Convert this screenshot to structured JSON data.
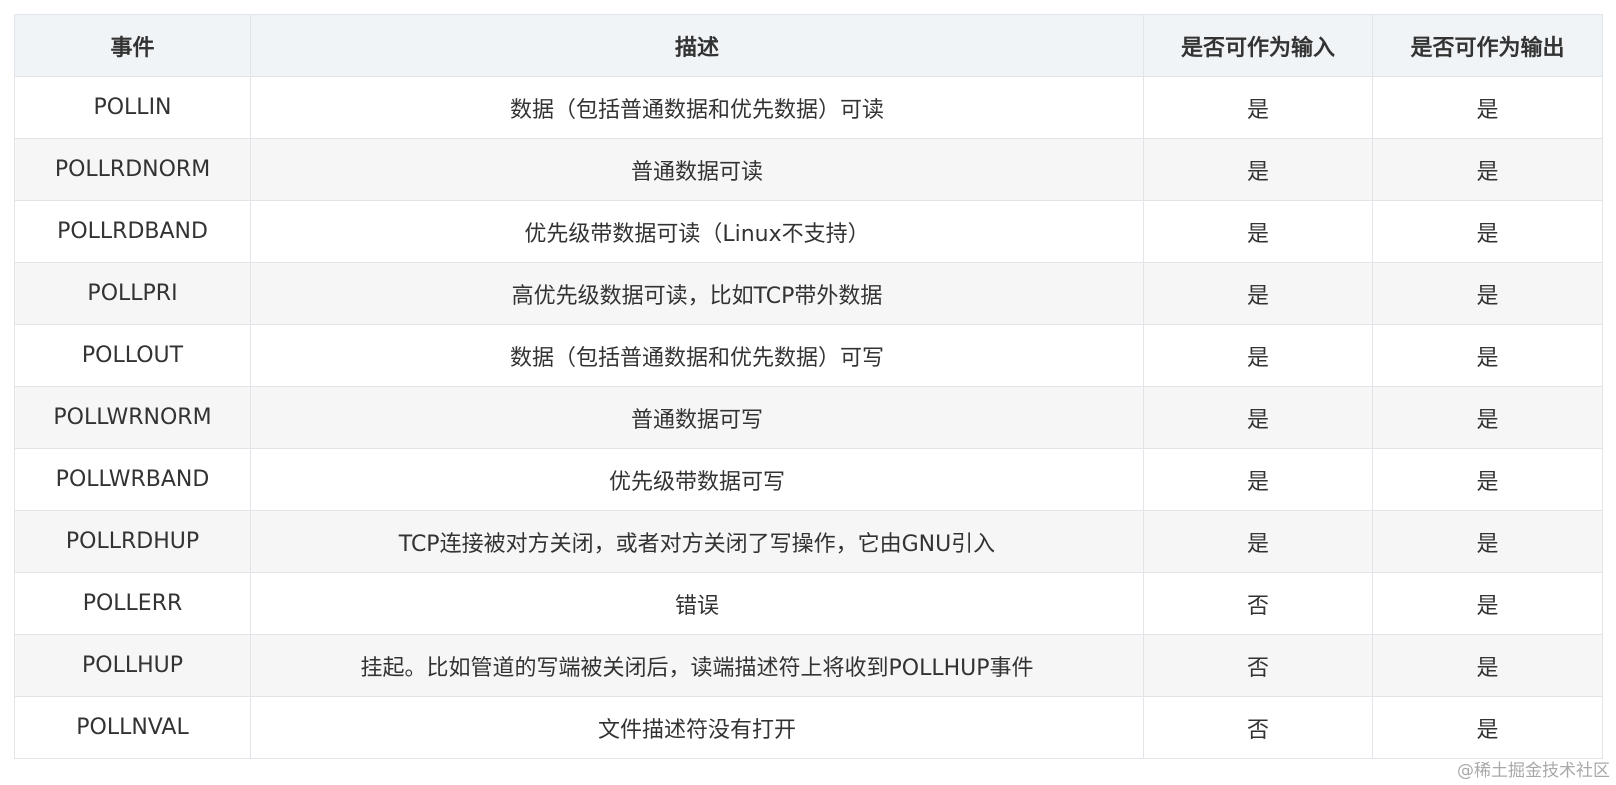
{
  "headers": [
    "事件",
    "描述",
    "是否可作为输入",
    "是否可作为输出"
  ],
  "rows": [
    {
      "event": "POLLIN",
      "desc": "数据（包括普通数据和优先数据）可读",
      "input": "是",
      "output": "是"
    },
    {
      "event": "POLLRDNORM",
      "desc": "普通数据可读",
      "input": "是",
      "output": "是"
    },
    {
      "event": "POLLRDBAND",
      "desc": "优先级带数据可读（Linux不支持）",
      "input": "是",
      "output": "是"
    },
    {
      "event": "POLLPRI",
      "desc": "高优先级数据可读，比如TCP带外数据",
      "input": "是",
      "output": "是"
    },
    {
      "event": "POLLOUT",
      "desc": "数据（包括普通数据和优先数据）可写",
      "input": "是",
      "output": "是"
    },
    {
      "event": "POLLWRNORM",
      "desc": "普通数据可写",
      "input": "是",
      "output": "是"
    },
    {
      "event": "POLLWRBAND",
      "desc": "优先级带数据可写",
      "input": "是",
      "output": "是"
    },
    {
      "event": "POLLRDHUP",
      "desc": "TCP连接被对方关闭，或者对方关闭了写操作，它由GNU引入",
      "input": "是",
      "output": "是"
    },
    {
      "event": "POLLERR",
      "desc": "错误",
      "input": "否",
      "output": "是"
    },
    {
      "event": "POLLHUP",
      "desc": "挂起。比如管道的写端被关闭后，读端描述符上将收到POLLHUP事件",
      "input": "否",
      "output": "是"
    },
    {
      "event": "POLLNVAL",
      "desc": "文件描述符没有打开",
      "input": "否",
      "output": "是"
    }
  ],
  "watermark": "@稀土掘金技术社区"
}
